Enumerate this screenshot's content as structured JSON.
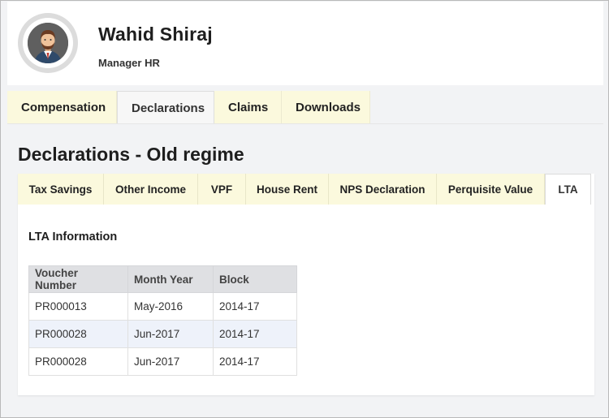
{
  "profile": {
    "name": "Wahid Shiraj",
    "role": "Manager HR"
  },
  "main_tabs": [
    {
      "label": "Compensation",
      "active": false
    },
    {
      "label": "Declarations",
      "active": true
    },
    {
      "label": "Claims",
      "active": false
    },
    {
      "label": "Downloads",
      "active": false
    }
  ],
  "page_title": "Declarations - Old regime",
  "sub_tabs": [
    {
      "label": "Tax Savings",
      "active": false
    },
    {
      "label": "Other Income",
      "active": false
    },
    {
      "label": "VPF",
      "active": false
    },
    {
      "label": "House Rent",
      "active": false
    },
    {
      "label": "NPS Declaration",
      "active": false
    },
    {
      "label": "Perquisite Value",
      "active": false
    },
    {
      "label": "LTA",
      "active": true
    }
  ],
  "lta": {
    "section_title": "LTA Information",
    "columns": [
      "Voucher Number",
      "Month Year",
      "Block"
    ],
    "rows": [
      [
        "PR000013",
        "May-2016",
        "2014-17"
      ],
      [
        "PR000028",
        "Jun-2017",
        "2014-17"
      ],
      [
        "PR000028",
        "Jun-2017",
        "2014-17"
      ]
    ]
  },
  "colors": {
    "tab_bg": "#fbf9dd",
    "page_bg": "#f2f3f5",
    "table_header_bg": "#dfe0e3",
    "row_alt_bg": "#eef2fa"
  }
}
